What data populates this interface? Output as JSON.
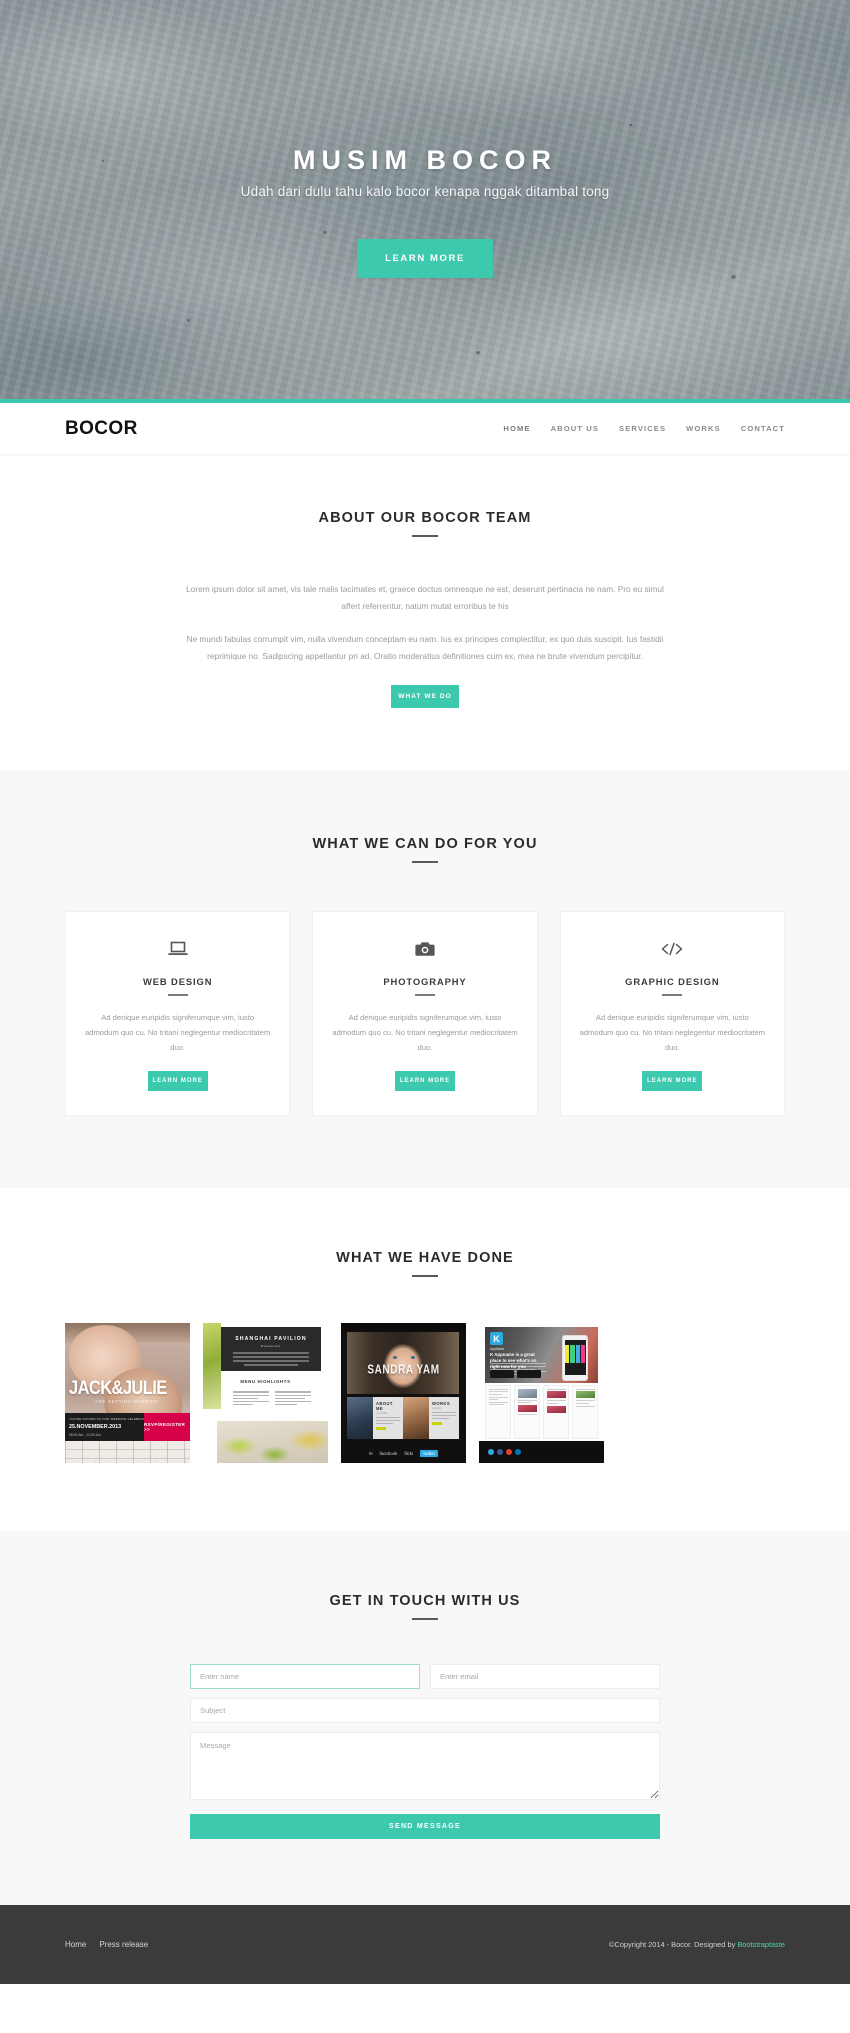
{
  "hero": {
    "title": "MUSIM BOCOR",
    "subtitle": "Udah dari dulu tahu kalo bocor kenapa nggak ditambal tong",
    "cta_label": "LEARN MORE",
    "background_icon": "sand-beach-photo"
  },
  "nav": {
    "brand": "BOCOR",
    "items": [
      {
        "label": "HOME"
      },
      {
        "label": "ABOUT US"
      },
      {
        "label": "SERVICES"
      },
      {
        "label": "WORKS"
      },
      {
        "label": "CONTACT"
      }
    ]
  },
  "about": {
    "title": "ABOUT OUR BOCOR TEAM",
    "paragraph1": "Lorem ipsum dolor sit amet, vis tale malis tacimates et, graece doctus omnesque ne est, deserunt pertinacia ne nam. Pro eu simul affert referrentur, natum mutat erroribus te his",
    "paragraph2": "Ne mundi fabulas corrumpit vim, nulla vivendum conceptam eu nam. Ius ex principes complectitur, ex quo duis suscipit. Ius fastidii reprimique no. Sadipscing appellantur pri ad. Oratio moderatius definitiones cum ex, mea ne brute vivendum percipitur.",
    "cta_label": "WHAT WE DO"
  },
  "services": {
    "title": "WHAT WE CAN DO FOR YOU",
    "cards": [
      {
        "icon": "laptop-icon",
        "title": "WEB DESIGN",
        "text": "Ad denique euripidis signiferumque vim, iusto admodum quo cu. No tritani neglegentur mediocritatem duo.",
        "cta_label": "LEARN MORE"
      },
      {
        "icon": "camera-icon",
        "title": "PHOTOGRAPHY",
        "text": "Ad denique euripidis signiferumque vim, iusto admodum quo cu. No tritani neglegentur mediocritatem duo.",
        "cta_label": "LEARN MORE"
      },
      {
        "icon": "code-icon",
        "title": "GRAPHIC DESIGN",
        "text": "Ad denique euripidis signiferumque vim, iusto admodum quo cu. No tritani neglegentur mediocritatem duo.",
        "cta_label": "LEARN MORE"
      }
    ]
  },
  "portfolio": {
    "title": "WHAT WE HAVE DONE",
    "works": [
      {
        "name": "jack-and-julie",
        "headline": "JACK&JULIE",
        "subline": "ARE GETTING MARRIED",
        "meta_small": "YOU'RE INVITED TO OUR WEDDING CELEBRATION, PARK, SAN ISLAND, NY",
        "date": "25.NOVEMBER.2013",
        "time": "08:00 Am - 12:00 Am",
        "badge": "RSVP/REGISTER >>"
      },
      {
        "name": "shanghai-pavilion",
        "headline": "SHANGHAI PAVILION",
        "subline": "Restaurant",
        "section_label": "MENU HIGHLIGHTS"
      },
      {
        "name": "sandra-yam",
        "headline": "SANDRA YAM",
        "tiles": [
          {
            "title": "ABOUT ME",
            "sub": "my profile"
          },
          {
            "title": "WORKS",
            "sub": "portfolio"
          }
        ],
        "social": [
          "facebook",
          "flickr",
          "twitter"
        ]
      },
      {
        "name": "k-appname",
        "logo": "K",
        "brand": "AppName",
        "headline": "K Appname is a great place to see what's on right now for you",
        "store_badges": [
          "App Store",
          "Google play"
        ]
      }
    ]
  },
  "contact": {
    "title": "GET IN TOUCH WITH US",
    "name_placeholder": "Enter name",
    "name_value": "",
    "email_placeholder": "Enter email",
    "email_value": "",
    "subject_placeholder": "Subject",
    "subject_value": "",
    "message_placeholder": "Message",
    "message_value": "",
    "submit_label": "SEND MESSAGE"
  },
  "footer": {
    "links": [
      {
        "label": "Home"
      },
      {
        "label": "Press release"
      }
    ],
    "copyright_prefix": "©Copyright 2014 - Bocor. Designed by ",
    "copyright_link": "Bootstraptaste"
  },
  "theme": {
    "accent": "#3cc9ae",
    "accent_link": "#4fd3b6",
    "footer_bg": "#3b3b3b",
    "grey_section_bg": "#f8f8f8",
    "body_text": "#9b9b9b",
    "heading_text": "#2b2b2b"
  }
}
